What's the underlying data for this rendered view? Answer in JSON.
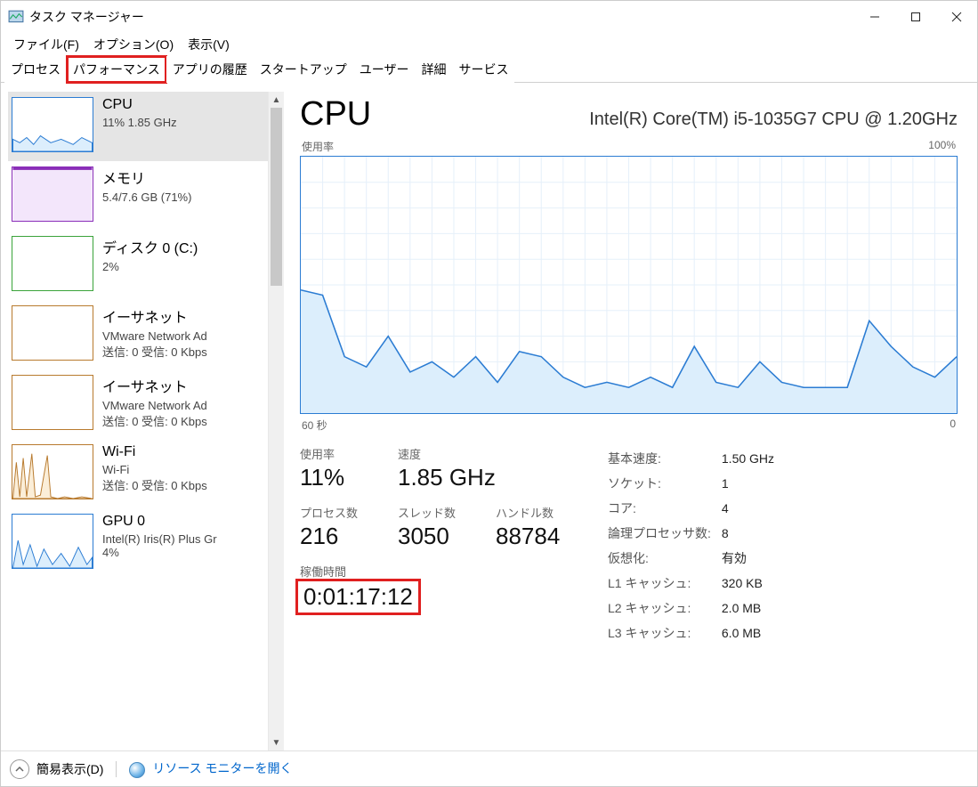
{
  "window": {
    "title": "タスク マネージャー"
  },
  "menu": {
    "file": "ファイル(F)",
    "options": "オプション(O)",
    "view": "表示(V)"
  },
  "tabs": {
    "processes": "プロセス",
    "performance": "パフォーマンス",
    "apphistory": "アプリの履歴",
    "startup": "スタートアップ",
    "users": "ユーザー",
    "details": "詳細",
    "services": "サービス"
  },
  "sidebar": {
    "items": [
      {
        "title": "CPU",
        "sub": "11%  1.85 GHz",
        "color": "#2b7cd3",
        "fill": "#dceefc"
      },
      {
        "title": "メモリ",
        "sub": "5.4/7.6 GB (71%)",
        "color": "#8a2eb8",
        "fill": "#f3e6fb"
      },
      {
        "title": "ディスク 0 (C:)",
        "sub": "2%",
        "color": "#3aa33a",
        "fill": "#e4f5e4"
      },
      {
        "title": "イーサネット",
        "sub": "VMware Network Ad",
        "sub2": "送信: 0  受信: 0 Kbps",
        "color": "#b87a2e",
        "fill": "#fff"
      },
      {
        "title": "イーサネット",
        "sub": "VMware Network Ad",
        "sub2": "送信: 0  受信: 0 Kbps",
        "color": "#b87a2e",
        "fill": "#fff"
      },
      {
        "title": "Wi-Fi",
        "sub": "Wi-Fi",
        "sub2": "送信: 0  受信: 0 Kbps",
        "color": "#b87a2e",
        "fill": "#fbeed8"
      },
      {
        "title": "GPU 0",
        "sub": "Intel(R) Iris(R) Plus Gr",
        "sub2": "4%",
        "color": "#2b7cd3",
        "fill": "#dceefc"
      }
    ]
  },
  "detail": {
    "heading": "CPU",
    "model": "Intel(R) Core(TM) i5-1035G7 CPU @ 1.20GHz",
    "chart_top_left": "使用率",
    "chart_top_right": "100%",
    "chart_bot_left": "60 秒",
    "chart_bot_right": "0",
    "stats_left": {
      "usage_lbl": "使用率",
      "usage_val": "11%",
      "speed_lbl": "速度",
      "speed_val": "1.85 GHz",
      "proc_lbl": "プロセス数",
      "proc_val": "216",
      "thread_lbl": "スレッド数",
      "thread_val": "3050",
      "handle_lbl": "ハンドル数",
      "handle_val": "88784",
      "uptime_lbl": "稼働時間",
      "uptime_val": "0:01:17:12"
    },
    "stats_right": {
      "base_lbl": "基本速度:",
      "base_val": "1.50 GHz",
      "sockets_lbl": "ソケット:",
      "sockets_val": "1",
      "cores_lbl": "コア:",
      "cores_val": "4",
      "logical_lbl": "論理プロセッサ数:",
      "logical_val": "8",
      "virt_lbl": "仮想化:",
      "virt_val": "有効",
      "l1_lbl": "L1 キャッシュ:",
      "l1_val": "320 KB",
      "l2_lbl": "L2 キャッシュ:",
      "l2_val": "2.0 MB",
      "l3_lbl": "L3 キャッシュ:",
      "l3_val": "6.0 MB"
    }
  },
  "statusbar": {
    "simple": "簡易表示(D)",
    "resmon": "リソース モニターを開く"
  },
  "chart_data": {
    "type": "line",
    "title": "CPU 使用率",
    "xlabel": "60 秒",
    "ylabel": "使用率",
    "ylim": [
      0,
      100
    ],
    "x_seconds_ago": [
      60,
      58,
      56,
      54,
      52,
      50,
      48,
      46,
      44,
      42,
      40,
      38,
      36,
      34,
      32,
      30,
      28,
      26,
      24,
      22,
      20,
      18,
      16,
      14,
      12,
      10,
      8,
      6,
      4,
      2,
      0
    ],
    "values": [
      48,
      46,
      22,
      18,
      30,
      16,
      20,
      14,
      22,
      12,
      24,
      22,
      14,
      10,
      12,
      10,
      14,
      10,
      26,
      12,
      10,
      20,
      12,
      10,
      10,
      10,
      36,
      26,
      18,
      14,
      22
    ]
  }
}
